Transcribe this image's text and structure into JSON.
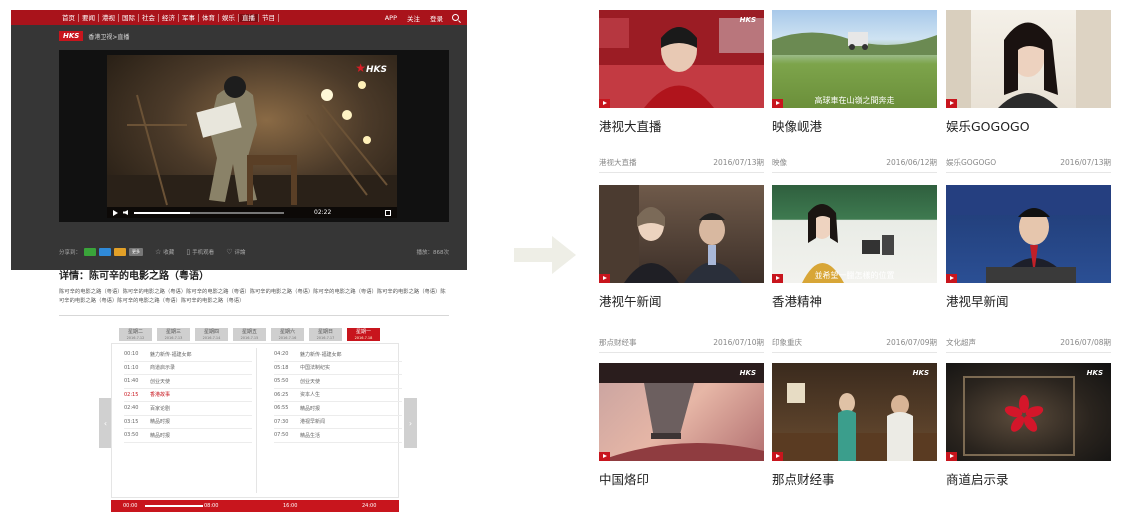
{
  "player_page": {
    "nav": {
      "items": [
        "首页",
        "要闻",
        "港视",
        "国际",
        "社会",
        "经济",
        "军事",
        "体育",
        "娱乐",
        "直播",
        "节目"
      ],
      "active_index": 9,
      "right_items": [
        "APP",
        "关注",
        "登录"
      ]
    },
    "logo": "HKS",
    "breadcrumb": "香港卫视>直播",
    "video": {
      "logo": "HKS",
      "time": "02:22",
      "progress_fraction": 0.37
    },
    "share": {
      "label": "分享到：",
      "more": "更多",
      "collect": "收藏",
      "mobile": "手机观看",
      "comment": "评論",
      "views": "播放：868次"
    },
    "detail_title": "详情：陈可辛的电影之路（粤语）",
    "detail_desc": "陈可辛的电影之路（粤语）陈可辛的电影之路（粤语）陈可辛的电影之路（粤语）陈可辛的电影之路（粤语）陈可辛的电影之路（粤语）陈可辛的电影之路（粤语）陈可辛的电影之路（粤语）陈可辛的电影之路（粤语）陈可辛的电影之路（粤语）",
    "schedule": {
      "days": [
        {
          "label": "星期二",
          "date": "2016.7.12"
        },
        {
          "label": "星期三",
          "date": "2016.7.13"
        },
        {
          "label": "星期四",
          "date": "2016.7.14"
        },
        {
          "label": "星期五",
          "date": "2016.7.15"
        },
        {
          "label": "星期六",
          "date": "2016.7.16"
        },
        {
          "label": "星期日",
          "date": "2016.7.17"
        },
        {
          "label": "星期一",
          "date": "2016.7.18"
        }
      ],
      "active_day": 6,
      "left": [
        {
          "time": "00:10",
          "title": "魅力新传·福建女郎"
        },
        {
          "time": "01:10",
          "title": "商道启示录"
        },
        {
          "time": "01:40",
          "title": "创业天使"
        },
        {
          "time": "02:15",
          "title": "香港故事"
        },
        {
          "time": "02:40",
          "title": "百家论剧"
        },
        {
          "time": "03:15",
          "title": "精品时报"
        },
        {
          "time": "03:50",
          "title": "精品时报"
        }
      ],
      "current_index": 3,
      "right": [
        {
          "time": "04:20",
          "title": "魅力新传·福建女郎"
        },
        {
          "time": "05:18",
          "title": "中国法制纪实"
        },
        {
          "time": "05:50",
          "title": "创业天使"
        },
        {
          "time": "06:25",
          "title": "资本人生"
        },
        {
          "time": "06:55",
          "title": "精品时报"
        },
        {
          "time": "07:30",
          "title": "港视早新闻"
        },
        {
          "time": "07:50",
          "title": "精品生活"
        }
      ],
      "timeline": [
        "00:00",
        "08:00",
        "16:00",
        "24:00"
      ]
    }
  },
  "grid": {
    "rows": [
      [
        {
          "title": "港视大直播",
          "meta_left": "港视大直播",
          "meta_right": "2016/07/13期"
        },
        {
          "title": "映像岘港",
          "meta_left": "映像",
          "meta_right": "2016/06/12期",
          "caption": "高球車在山嶺之間奔走"
        },
        {
          "title": "娱乐GOGOGO",
          "meta_left": "娱乐GOGOGO",
          "meta_right": "2016/07/13期"
        }
      ],
      [
        {
          "title": "港视午新闻",
          "meta_left": "那点财经事",
          "meta_right": "2016/07/10期"
        },
        {
          "title": "香港精神",
          "meta_left": "印象重庆",
          "meta_right": "2016/07/09期",
          "caption": "並希望一臘怎樣的位置"
        },
        {
          "title": "港视早新闻",
          "meta_left": "文化超声",
          "meta_right": "2016/07/08期"
        }
      ],
      [
        {
          "title": "中国烙印"
        },
        {
          "title": "那点财经事"
        },
        {
          "title": "商道启示录"
        }
      ]
    ],
    "brand_tag": "HKS",
    "accent": "#c8151d"
  }
}
